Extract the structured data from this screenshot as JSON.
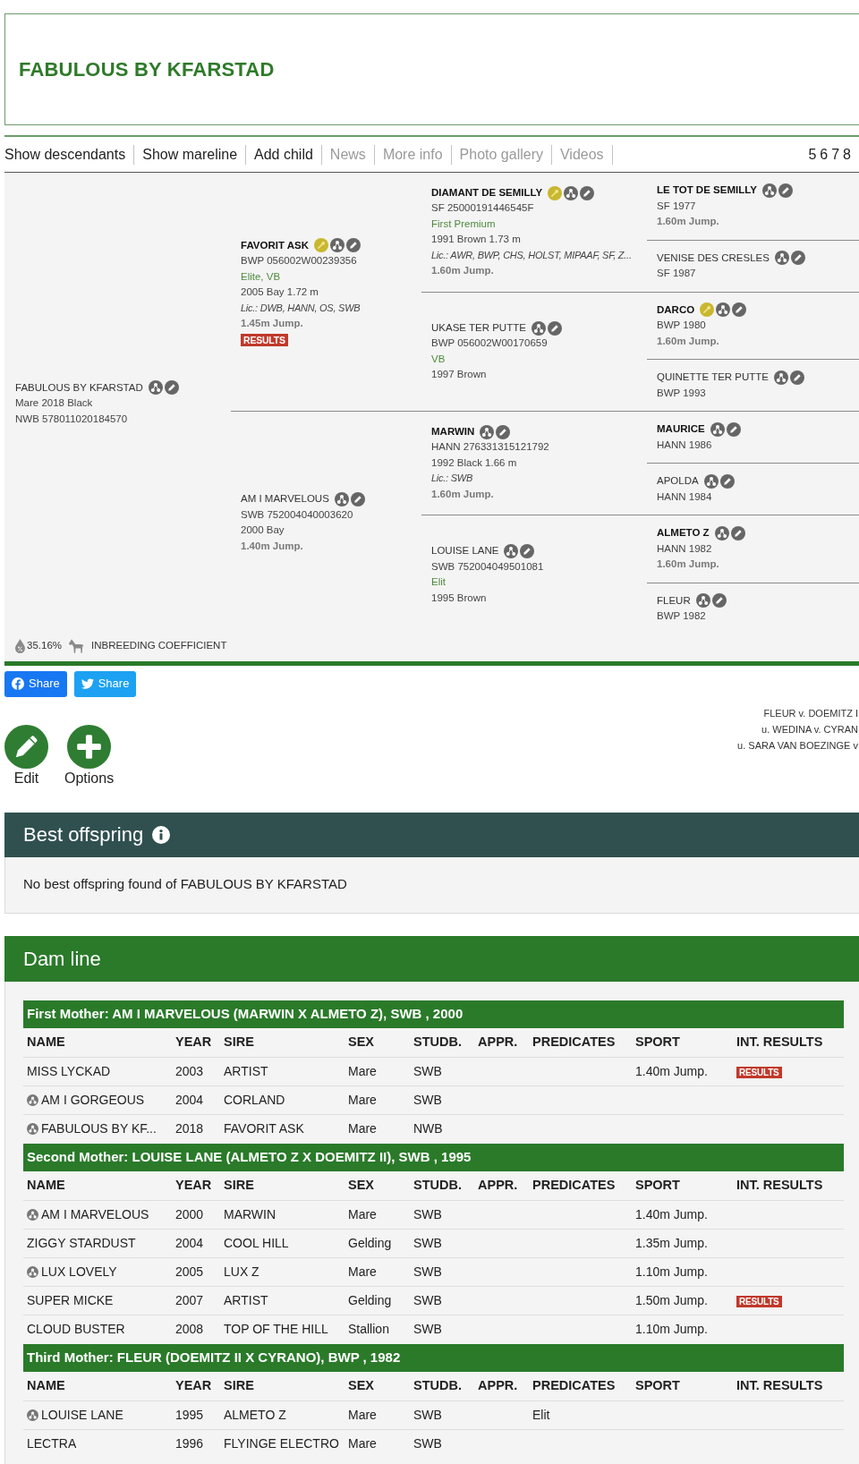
{
  "header": {
    "title": "FABULOUS BY KFARSTAD"
  },
  "nav": {
    "links": [
      {
        "label": "Show descendants",
        "disabled": false
      },
      {
        "label": "Show mareline",
        "disabled": false
      },
      {
        "label": "Add child",
        "disabled": false
      },
      {
        "label": "News",
        "disabled": true
      },
      {
        "label": "More info",
        "disabled": true
      },
      {
        "label": "Photo gallery",
        "disabled": true
      },
      {
        "label": "Videos",
        "disabled": true
      }
    ],
    "generations": [
      "5",
      "6",
      "7",
      "8"
    ]
  },
  "pedigree": {
    "horse": {
      "name": "FABULOUS BY KFARSTAD",
      "highlighted": false,
      "licensed": false,
      "lines": [
        {
          "kind": "info",
          "text": "Mare 2018 Black"
        },
        {
          "kind": "info",
          "text": "NWB 578011020184570"
        }
      ],
      "parents": [
        {
          "name": "FAVORIT ASK",
          "highlighted": true,
          "licensed": true,
          "lines": [
            {
              "kind": "info",
              "text": "BWP 056002W00239356"
            },
            {
              "kind": "predicate",
              "text": "Elite, VB"
            },
            {
              "kind": "info",
              "text": "2005 Bay 1.72 m"
            },
            {
              "kind": "licence",
              "text": "Lic.: DWB, HANN, OS, SWB"
            },
            {
              "kind": "sport",
              "text": "1.45m Jump."
            }
          ],
          "badge": "RESULTS",
          "parents": [
            {
              "name": "DIAMANT DE SEMILLY",
              "highlighted": true,
              "licensed": true,
              "lines": [
                {
                  "kind": "info",
                  "text": "SF 25000191446545F"
                },
                {
                  "kind": "predicate",
                  "text": "First Premium"
                },
                {
                  "kind": "info",
                  "text": "1991 Brown 1.73 m"
                },
                {
                  "kind": "licence",
                  "text": "Lic.: AWR, BWP, CHS, HOLST, MIPAAF, SF, Z..."
                },
                {
                  "kind": "sport",
                  "text": "1.60m Jump."
                }
              ],
              "parents": [
                {
                  "name": "LE TOT DE SEMILLY",
                  "highlighted": true,
                  "licensed": false,
                  "lines": [
                    {
                      "kind": "info",
                      "text": "SF 1977"
                    },
                    {
                      "kind": "sport",
                      "text": "1.60m Jump."
                    }
                  ]
                },
                {
                  "name": "VENISE DES CRESLES",
                  "highlighted": false,
                  "licensed": false,
                  "lines": [
                    {
                      "kind": "info",
                      "text": "SF 1987"
                    }
                  ]
                }
              ]
            },
            {
              "name": "UKASE TER PUTTE",
              "highlighted": false,
              "licensed": false,
              "lines": [
                {
                  "kind": "info",
                  "text": "BWP 056002W00170659"
                },
                {
                  "kind": "predicate",
                  "text": "VB"
                },
                {
                  "kind": "info",
                  "text": "1997 Brown"
                }
              ],
              "parents": [
                {
                  "name": "DARCO",
                  "highlighted": true,
                  "licensed": true,
                  "lines": [
                    {
                      "kind": "info",
                      "text": "BWP 1980"
                    },
                    {
                      "kind": "sport",
                      "text": "1.60m Jump."
                    }
                  ]
                },
                {
                  "name": "QUINETTE TER PUTTE",
                  "highlighted": false,
                  "licensed": false,
                  "lines": [
                    {
                      "kind": "info",
                      "text": "BWP 1993"
                    }
                  ]
                }
              ]
            }
          ]
        },
        {
          "name": "AM I MARVELOUS",
          "highlighted": false,
          "licensed": false,
          "lines": [
            {
              "kind": "info",
              "text": "SWB 752004040003620"
            },
            {
              "kind": "info",
              "text": "2000 Bay"
            },
            {
              "kind": "sport",
              "text": "1.40m Jump."
            }
          ],
          "parents": [
            {
              "name": "MARWIN",
              "highlighted": true,
              "licensed": false,
              "lines": [
                {
                  "kind": "info",
                  "text": "HANN 276331315121792"
                },
                {
                  "kind": "info",
                  "text": "1992 Black 1.66 m"
                },
                {
                  "kind": "licence",
                  "text": "Lic.: SWB"
                },
                {
                  "kind": "sport",
                  "text": "1.60m Jump."
                }
              ],
              "parents": [
                {
                  "name": "MAURICE",
                  "highlighted": true,
                  "licensed": false,
                  "lines": [
                    {
                      "kind": "info",
                      "text": "HANN 1986"
                    }
                  ]
                },
                {
                  "name": "APOLDA",
                  "highlighted": false,
                  "licensed": false,
                  "lines": [
                    {
                      "kind": "info",
                      "text": "HANN 1984"
                    }
                  ]
                }
              ]
            },
            {
              "name": "LOUISE LANE",
              "highlighted": false,
              "licensed": false,
              "lines": [
                {
                  "kind": "info",
                  "text": "SWB 752004049501081"
                },
                {
                  "kind": "predicate",
                  "text": "Elit"
                },
                {
                  "kind": "info",
                  "text": "1995 Brown"
                }
              ],
              "parents": [
                {
                  "name": "ALMETO Z",
                  "highlighted": true,
                  "licensed": false,
                  "lines": [
                    {
                      "kind": "info",
                      "text": "HANN 1982"
                    },
                    {
                      "kind": "sport",
                      "text": "1.60m Jump."
                    }
                  ]
                },
                {
                  "name": "FLEUR",
                  "highlighted": false,
                  "licensed": false,
                  "lines": [
                    {
                      "kind": "info",
                      "text": "BWP 1982"
                    }
                  ]
                }
              ]
            }
          ]
        }
      ]
    },
    "inbreeding": {
      "value": "35.16%",
      "label": "INBREEDING COEFFICIENT"
    }
  },
  "share": [
    {
      "kind": "facebook",
      "label": "Share"
    },
    {
      "kind": "twitter",
      "label": "Share"
    }
  ],
  "actions": [
    {
      "kind": "edit",
      "label": "Edit"
    },
    {
      "kind": "options",
      "label": "Options"
    }
  ],
  "dam_line_summary": [
    "FLEUR v. DOEMITZ I",
    "u. WEDINA v. CYRAN",
    "u. SARA VAN BOEZINGE v"
  ],
  "best_offspring": {
    "title": "Best offspring",
    "message": "No best offspring found of FABULOUS BY KFARSTAD"
  },
  "dam_line": {
    "title": "Dam line",
    "groups": [
      {
        "title": "First Mother: AM I MARVELOUS (MARWIN X ALMETO Z), SWB , 2000",
        "columns": [
          "NAME",
          "YEAR",
          "SIRE",
          "SEX",
          "STUDB.",
          "APPR.",
          "PREDICATES",
          "SPORT",
          "INT. RESULTS"
        ],
        "rows": [
          {
            "pedigree_link": false,
            "name": "MISS LYCKAD",
            "year": "2003",
            "sire": "ARTIST",
            "sex": "Mare",
            "studbook": "SWB",
            "sport": "1.40m Jump.",
            "int_results": "RESULTS"
          },
          {
            "pedigree_link": true,
            "name": "AM I GORGEOUS",
            "year": "2004",
            "sire": "CORLAND",
            "sex": "Mare",
            "studbook": "SWB"
          },
          {
            "pedigree_link": true,
            "name": "FABULOUS BY KF...",
            "year": "2018",
            "sire": "FAVORIT ASK",
            "sex": "Mare",
            "studbook": "NWB"
          }
        ]
      },
      {
        "title": "Second Mother: LOUISE LANE (ALMETO Z X DOEMITZ II), SWB , 1995",
        "columns": [
          "NAME",
          "YEAR",
          "SIRE",
          "SEX",
          "STUDB.",
          "APPR.",
          "PREDICATES",
          "SPORT",
          "INT. RESULTS"
        ],
        "rows": [
          {
            "pedigree_link": true,
            "name": "AM I MARVELOUS",
            "year": "2000",
            "sire": "MARWIN",
            "sex": "Mare",
            "studbook": "SWB",
            "sport": "1.40m Jump."
          },
          {
            "pedigree_link": false,
            "name": "ZIGGY STARDUST",
            "year": "2004",
            "sire": "COOL HILL",
            "sex": "Gelding",
            "studbook": "SWB",
            "sport": "1.35m Jump."
          },
          {
            "pedigree_link": true,
            "name": "LUX LOVELY",
            "year": "2005",
            "sire": "LUX Z",
            "sex": "Mare",
            "studbook": "SWB",
            "sport": "1.10m Jump."
          },
          {
            "pedigree_link": false,
            "name": "SUPER MICKE",
            "year": "2007",
            "sire": "ARTIST",
            "sex": "Gelding",
            "studbook": "SWB",
            "sport": "1.50m Jump.",
            "int_results": "RESULTS"
          },
          {
            "pedigree_link": false,
            "name": "CLOUD BUSTER",
            "year": "2008",
            "sire": "TOP OF THE HILL",
            "sex": "Stallion",
            "studbook": "SWB",
            "sport": "1.10m Jump."
          }
        ]
      },
      {
        "title": "Third Mother: FLEUR (DOEMITZ II X CYRANO), BWP , 1982",
        "columns": [
          "NAME",
          "YEAR",
          "SIRE",
          "SEX",
          "STUDB.",
          "APPR.",
          "PREDICATES",
          "SPORT",
          "INT. RESULTS"
        ],
        "rows": [
          {
            "pedigree_link": true,
            "name": "LOUISE LANE",
            "year": "1995",
            "sire": "ALMETO Z",
            "sex": "Mare",
            "studbook": "SWB",
            "predicates": "Elit"
          },
          {
            "pedigree_link": false,
            "name": "LECTRA",
            "year": "1996",
            "sire": "FLYINGE ELECTRO",
            "sex": "Mare",
            "studbook": "SWB"
          }
        ]
      }
    ]
  }
}
